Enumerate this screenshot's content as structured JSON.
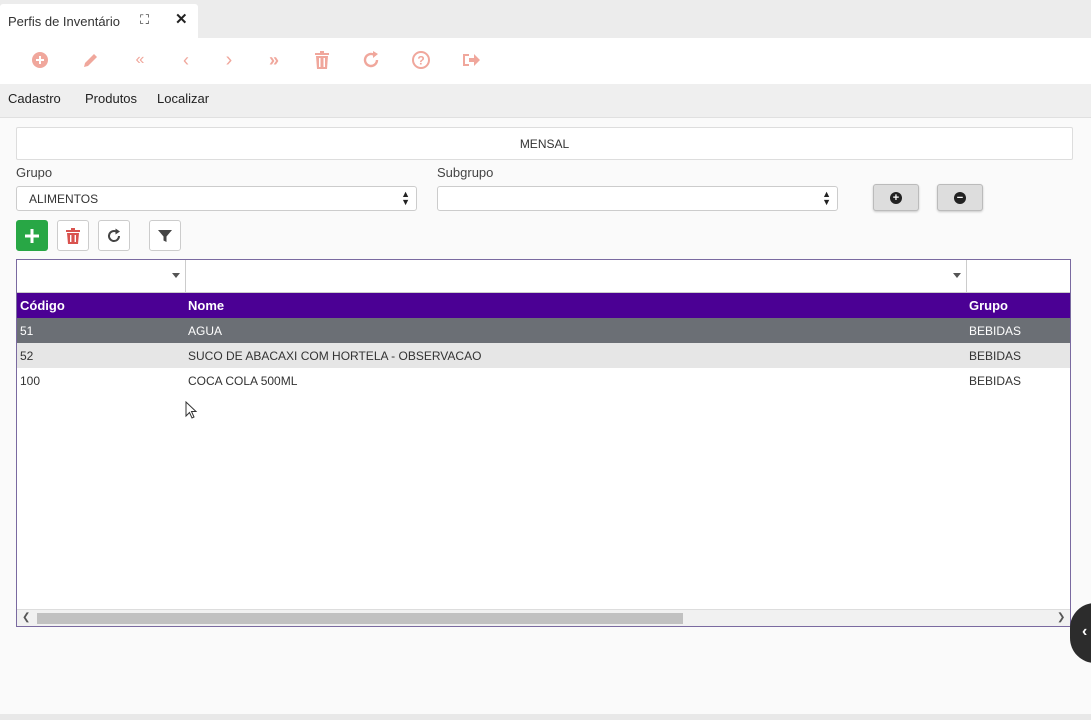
{
  "tab": {
    "title": "Perfis de Inventário"
  },
  "toolbar": {
    "icons": [
      "add-circle-icon",
      "edit-pencil-icon",
      "first-icon",
      "previous-icon",
      "next-icon",
      "last-icon",
      "delete-icon",
      "refresh-icon",
      "help-icon",
      "exit-icon"
    ],
    "color": "#f0a79c"
  },
  "menu": {
    "cadastro": "Cadastro",
    "produtos": "Produtos",
    "localizar": "Localizar"
  },
  "period": "MENSAL",
  "grupo": {
    "label": "Grupo",
    "value": "ALIMENTOS"
  },
  "subgrupo": {
    "label": "Subgrupo",
    "value": ""
  },
  "grid": {
    "columns": [
      "Código",
      "Nome",
      "Grupo"
    ],
    "rows": [
      {
        "codigo": "51",
        "nome": "AGUA",
        "grupo": "BEBIDAS"
      },
      {
        "codigo": "52",
        "nome": "SUCO DE ABACAXI COM HORTELA - OBSERVACAO",
        "grupo": "BEBIDAS"
      },
      {
        "codigo": "100",
        "nome": "COCA COLA 500ML",
        "grupo": "BEBIDAS"
      }
    ],
    "header_color": "#4b0094",
    "selected_row_color": "#6b6f75"
  }
}
